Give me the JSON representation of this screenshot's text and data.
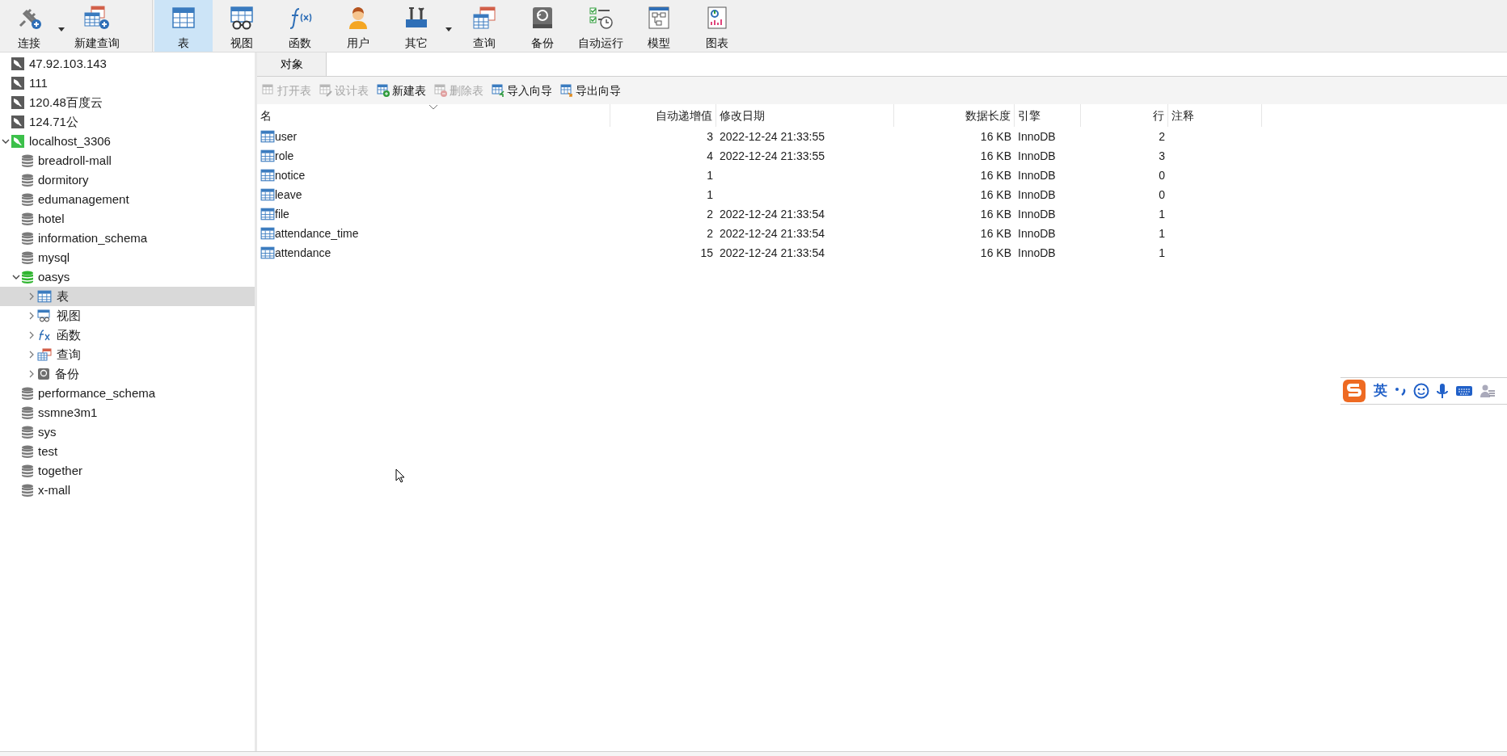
{
  "toolbar": {
    "left": [
      {
        "label": "连接",
        "kind": "plug",
        "dropdown": true
      },
      {
        "label": "新建查询",
        "kind": "newquery",
        "dropdown": false
      }
    ],
    "main": [
      {
        "label": "表",
        "kind": "table",
        "selected": true,
        "dropdown": false
      },
      {
        "label": "视图",
        "kind": "view",
        "selected": false,
        "dropdown": false
      },
      {
        "label": "函数",
        "kind": "function",
        "selected": false,
        "dropdown": false
      },
      {
        "label": "用户",
        "kind": "user",
        "selected": false,
        "dropdown": false
      },
      {
        "label": "其它",
        "kind": "tools",
        "selected": false,
        "dropdown": true
      },
      {
        "label": "查询",
        "kind": "query",
        "selected": false,
        "dropdown": false
      },
      {
        "label": "备份",
        "kind": "backup",
        "selected": false,
        "dropdown": false
      },
      {
        "label": "自动运行",
        "kind": "schedule",
        "selected": false,
        "dropdown": false
      },
      {
        "label": "模型",
        "kind": "model",
        "selected": false,
        "dropdown": false
      },
      {
        "label": "图表",
        "kind": "chart",
        "selected": false,
        "dropdown": false
      }
    ]
  },
  "sidebar": {
    "items": [
      {
        "label": "47.92.103.143",
        "kind": "connection",
        "active": false,
        "selected": false
      },
      {
        "label": "111",
        "kind": "connection",
        "active": false,
        "selected": false
      },
      {
        "label": "120.48百度云",
        "kind": "connection",
        "active": false,
        "selected": false
      },
      {
        "label": "124.71公",
        "kind": "connection",
        "active": false,
        "selected": false
      },
      {
        "label": "localhost_3306",
        "kind": "connection",
        "active": true,
        "selected": false,
        "expanded": true,
        "children": [
          {
            "label": "breadroll-mall",
            "kind": "database",
            "active": false,
            "selected": false
          },
          {
            "label": "dormitory",
            "kind": "database",
            "active": false,
            "selected": false
          },
          {
            "label": "edumanagement",
            "kind": "database",
            "active": false,
            "selected": false
          },
          {
            "label": "hotel",
            "kind": "database",
            "active": false,
            "selected": false
          },
          {
            "label": "information_schema",
            "kind": "database",
            "active": false,
            "selected": false
          },
          {
            "label": "mysql",
            "kind": "database",
            "active": false,
            "selected": false
          },
          {
            "label": "oasys",
            "kind": "database",
            "active": true,
            "selected": false,
            "expanded": true,
            "children": [
              {
                "label": "表",
                "kind": "table",
                "selected": true,
                "expanded": false
              },
              {
                "label": "视图",
                "kind": "view",
                "selected": false,
                "expanded": false
              },
              {
                "label": "函数",
                "kind": "function",
                "selected": false,
                "expanded": false
              },
              {
                "label": "查询",
                "kind": "query",
                "selected": false,
                "expanded": false
              },
              {
                "label": "备份",
                "kind": "backup",
                "selected": false,
                "expanded": false
              }
            ]
          },
          {
            "label": "performance_schema",
            "kind": "database",
            "active": false,
            "selected": false
          },
          {
            "label": "ssmne3m1",
            "kind": "database",
            "active": false,
            "selected": false
          },
          {
            "label": "sys",
            "kind": "database",
            "active": false,
            "selected": false
          },
          {
            "label": "test",
            "kind": "database",
            "active": false,
            "selected": false
          },
          {
            "label": "together",
            "kind": "database",
            "active": false,
            "selected": false
          },
          {
            "label": "x-mall",
            "kind": "database",
            "active": false,
            "selected": false
          }
        ]
      }
    ]
  },
  "tabs": [
    {
      "label": "对象",
      "selected": true
    }
  ],
  "object_toolbar": [
    {
      "label": "打开表",
      "kind": "open",
      "disabled": true
    },
    {
      "label": "设计表",
      "kind": "design",
      "disabled": true
    },
    {
      "label": "新建表",
      "kind": "new",
      "disabled": false
    },
    {
      "label": "删除表",
      "kind": "delete",
      "disabled": true
    },
    {
      "label": "导入向导",
      "kind": "import",
      "disabled": false
    },
    {
      "label": "导出向导",
      "kind": "export",
      "disabled": false
    }
  ],
  "table": {
    "columns": [
      {
        "label": "名",
        "kind": "text",
        "sorted": true
      },
      {
        "label": "自动递增值",
        "kind": "number",
        "sorted": false
      },
      {
        "label": "修改日期",
        "kind": "text",
        "sorted": false
      },
      {
        "label": "数据长度",
        "kind": "number",
        "sorted": false
      },
      {
        "label": "引擎",
        "kind": "text",
        "sorted": false
      },
      {
        "label": "行",
        "kind": "number",
        "sorted": false
      },
      {
        "label": "注释",
        "kind": "text",
        "sorted": false
      }
    ],
    "rows": [
      {
        "name": "user",
        "auto_increment": "3",
        "modified": "2022-12-24 21:33:55",
        "data_length": "16 KB",
        "engine": "InnoDB",
        "rows": "2"
      },
      {
        "name": "role",
        "auto_increment": "4",
        "modified": "2022-12-24 21:33:55",
        "data_length": "16 KB",
        "engine": "InnoDB",
        "rows": "3"
      },
      {
        "name": "notice",
        "auto_increment": "1",
        "data_length": "16 KB",
        "engine": "InnoDB",
        "rows": "0"
      },
      {
        "name": "leave",
        "auto_increment": "1",
        "data_length": "16 KB",
        "engine": "InnoDB",
        "rows": "0"
      },
      {
        "name": "file",
        "auto_increment": "2",
        "modified": "2022-12-24 21:33:54",
        "data_length": "16 KB",
        "engine": "InnoDB",
        "rows": "1"
      },
      {
        "name": "attendance_time",
        "auto_increment": "2",
        "modified": "2022-12-24 21:33:54",
        "data_length": "16 KB",
        "engine": "InnoDB",
        "rows": "1"
      },
      {
        "name": "attendance",
        "auto_increment": "15",
        "modified": "2022-12-24 21:33:54",
        "data_length": "16 KB",
        "engine": "InnoDB",
        "rows": "1"
      }
    ]
  },
  "ime_toolbar": {
    "language": "英"
  }
}
